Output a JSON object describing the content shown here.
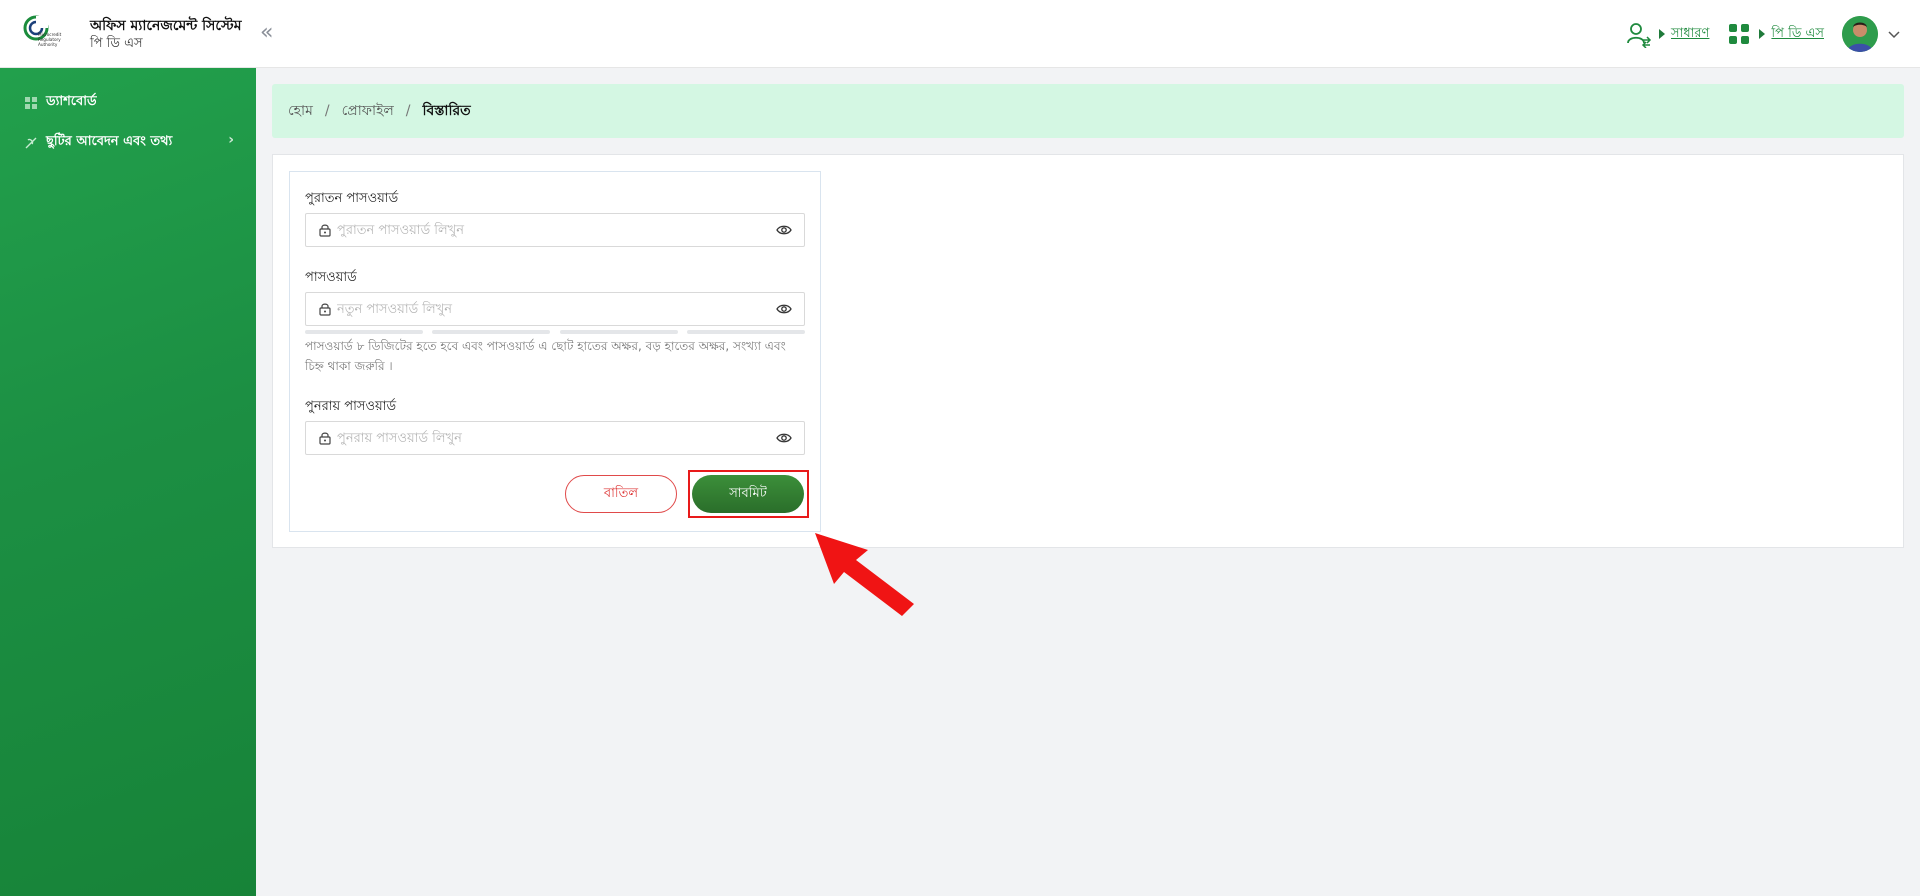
{
  "header": {
    "app_title": "অফিস ম্যানেজমেন্ট সিস্টেম",
    "app_subtitle": "পি ডি এস",
    "role_link": "সাধারণ",
    "module_link": "পি ডি এস",
    "logo_text": "Microcredit Regulatory Authority"
  },
  "sidebar": {
    "items": [
      {
        "label": "ড্যাশবোর্ড",
        "icon": "dashboard-grid-icon"
      },
      {
        "label": "ছুটির আবেদন এবং তথ্য",
        "icon": "leave-icon"
      }
    ]
  },
  "breadcrumb": {
    "home": "হোম",
    "profile": "প্রোফাইল",
    "current": "বিস্তারিত",
    "separator": "/"
  },
  "form": {
    "old_password": {
      "label": "পুরাতন পাসওয়ার্ড",
      "placeholder": "পুরাতন পাসওয়ার্ড লিখুন",
      "value": ""
    },
    "new_password": {
      "label": "পাসওয়ার্ড",
      "placeholder": "নতুন পাসওয়ার্ড লিখুন",
      "value": ""
    },
    "hint": "পাসওয়ার্ড ৮ ডিজিটের হতে হবে এবং পাসওয়ার্ড এ ছোট হাতের অক্ষর, বড় হাতের অক্ষর, সংখ্যা এবং চিহ্ন থাকা জরুরি ।",
    "confirm_password": {
      "label": "পুনরায় পাসওয়ার্ড",
      "placeholder": "পুনরায় পাসওয়ার্ড লিখুন",
      "value": ""
    },
    "cancel_label": "বাতিল",
    "submit_label": "সাবমিট"
  },
  "colors": {
    "primary": "#1f8a3e",
    "breadcrumb_bg": "#d4f7e3",
    "highlight": "#e81a1a"
  }
}
